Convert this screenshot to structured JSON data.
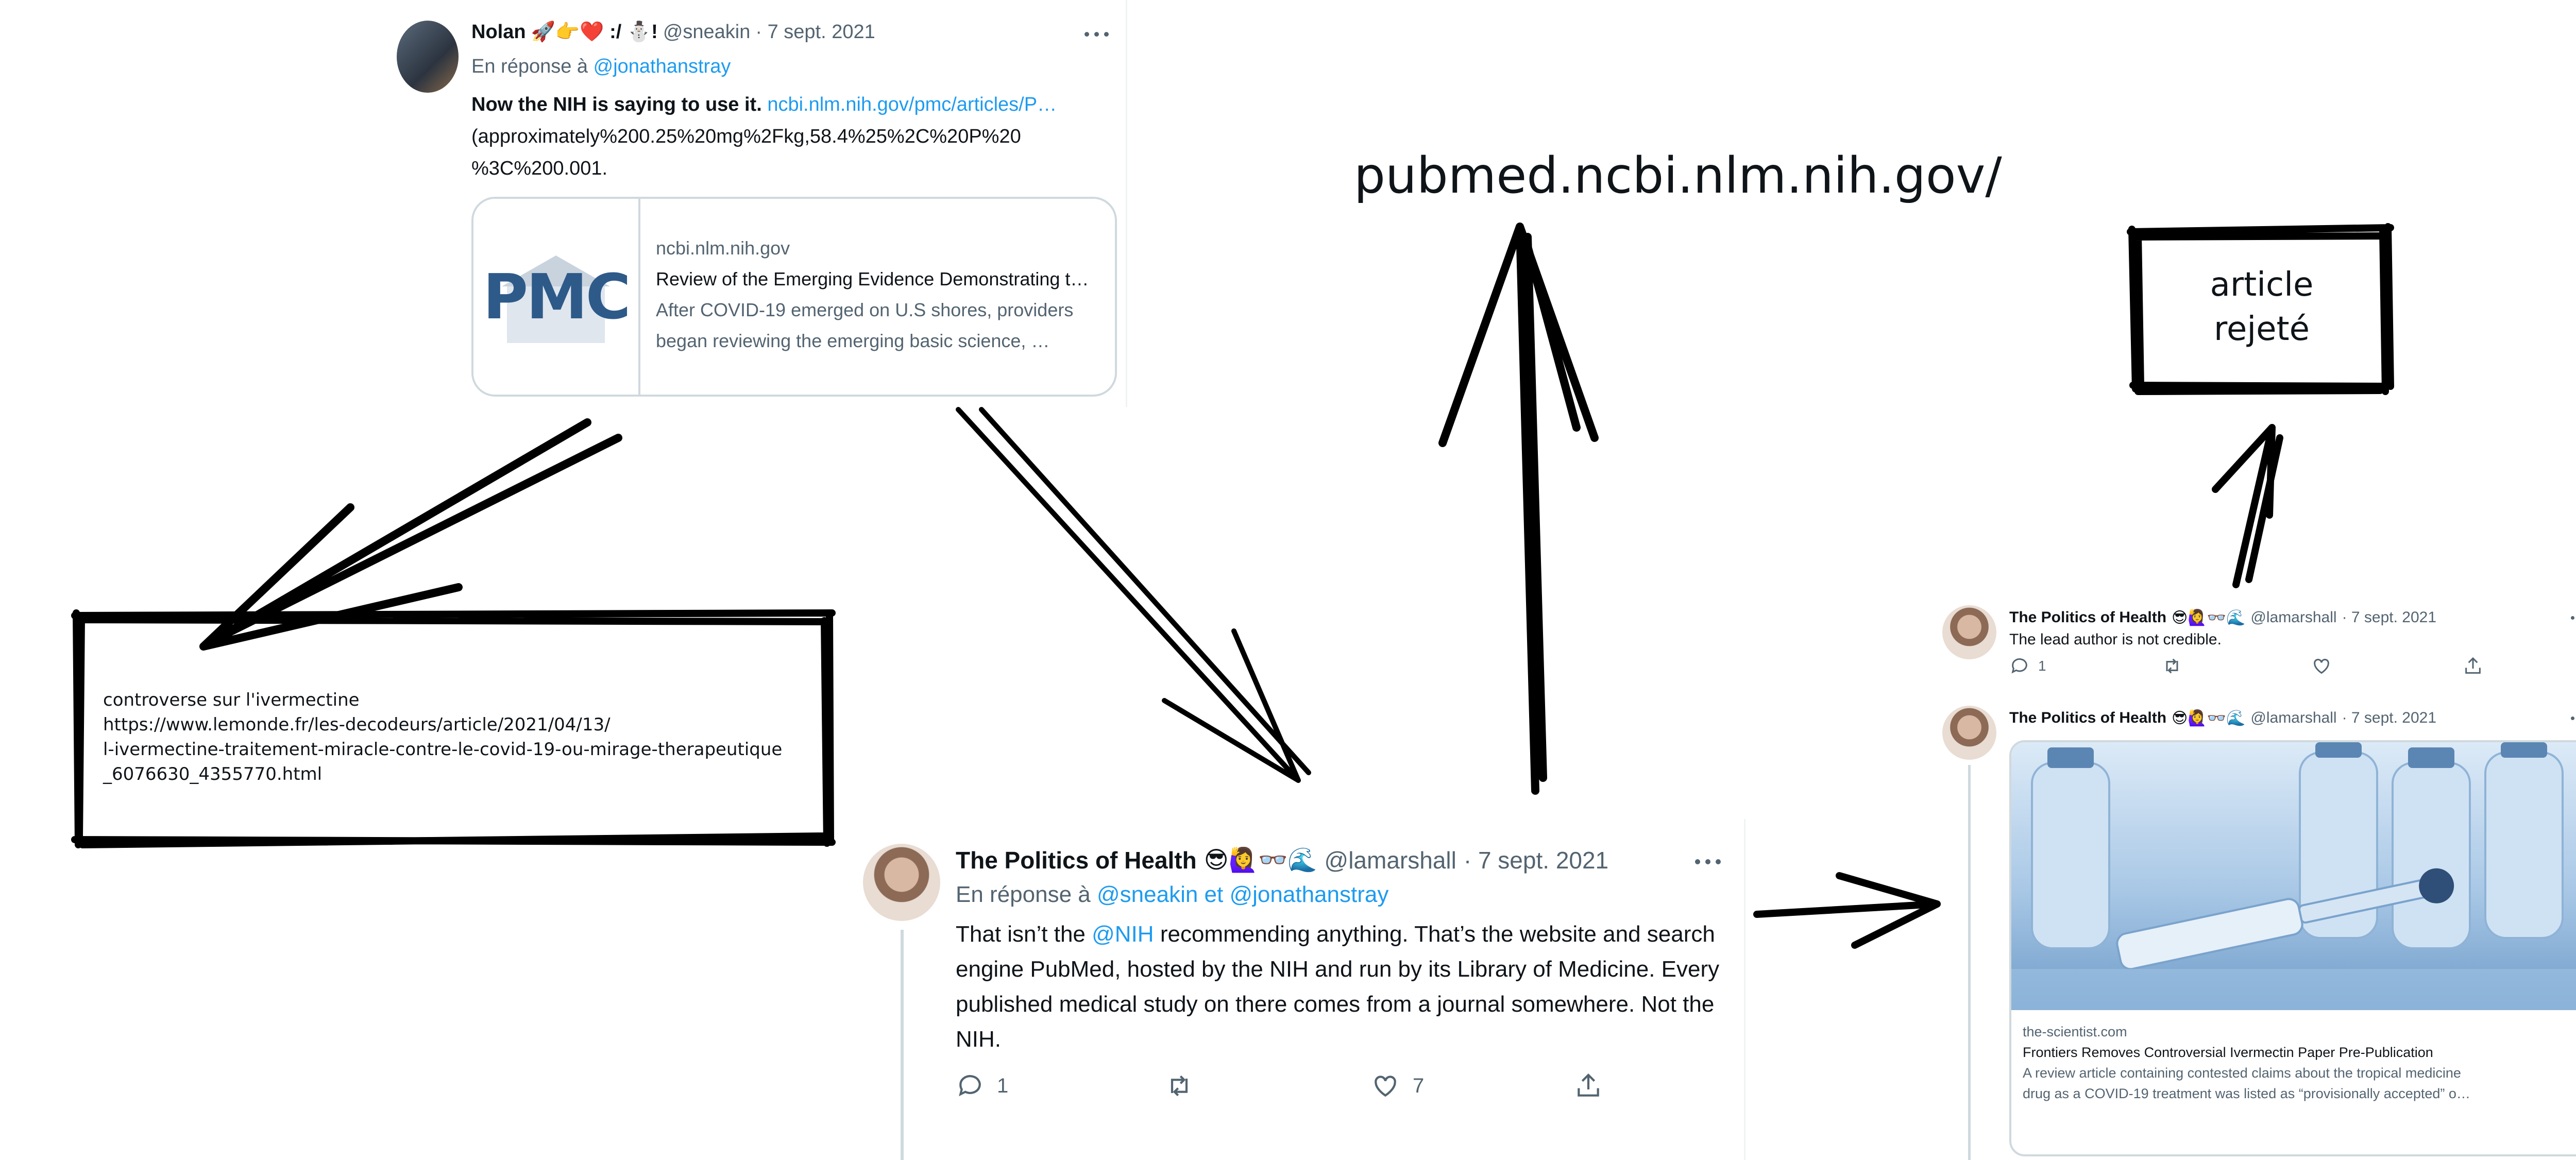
{
  "tweet1": {
    "author": "Nolan",
    "emoji": "🚀👉❤️ :/ ⛄!",
    "handle": "@sneakin",
    "date": "· 7 sept. 2021",
    "reply_prefix": "En réponse à",
    "reply_to": "@jonathanstray",
    "text_bold": "Now the NIH is saying to use it.",
    "text_link": "ncbi.nlm.nih.gov/pmc/articles/P…",
    "text_line2": "(approximately%200.25%20mg%2Fkg,58.4%25%2C%20P%20",
    "text_line3": "%3C%200.001.",
    "card": {
      "logo": "PMC",
      "domain": "ncbi.nlm.nih.gov",
      "title": "Review of the Emerging Evidence Demonstrating t…",
      "desc1": "After COVID-19 emerged on U.S shores, providers",
      "desc2": "began reviewing the emerging basic science, …"
    }
  },
  "note_box": {
    "line1": "controverse sur l'ivermectine",
    "line2": "https://www.lemonde.fr/les-decodeurs/article/2021/04/13/",
    "line3": "l-ivermectine-traitement-miracle-contre-le-covid-19-ou-mirage-therapeutique",
    "line4": "_6076630_4355770.html"
  },
  "pubmed_label": "pubmed.ncbi.nlm.nih.gov/",
  "rejected_box": {
    "line1": "article",
    "line2": "rejeté"
  },
  "tweet2": {
    "author": "The Politics of Health",
    "emoji": "😎🙋‍♀️👓🌊",
    "handle": "@lamarshall",
    "date": "· 7 sept. 2021",
    "reply_prefix": "En réponse à",
    "reply_to_1": "@sneakin",
    "reply_sep": "et",
    "reply_to_2": "@jonathanstray",
    "text_1a": "That isn’t the ",
    "text_1_mention": "@NIH",
    "text_1b": " recommending anything. That’s the website and search",
    "text_2": "engine PubMed, hosted by the NIH and run by its Library of Medicine. Every",
    "text_3": "published medical study on there comes from a journal somewhere. Not the",
    "text_4": "NIH.",
    "reply_count": "1",
    "like_count": "7"
  },
  "tweet3": {
    "author": "The Politics of Health",
    "emoji": "😎🙋‍♀️👓🌊",
    "handle": "@lamarshall",
    "date": "· 7 sept. 2021",
    "text": "The lead author is not credible.",
    "reply_count": "1"
  },
  "tweet4": {
    "author": "The Politics of Health",
    "emoji": "😎🙋‍♀️👓🌊",
    "handle": "@lamarshall",
    "date": "· 7 sept. 2021",
    "card": {
      "domain": "the-scientist.com",
      "title": "Frontiers Removes Controversial Ivermectin Paper Pre-Publication",
      "desc1": "A review article containing contested claims about the tropical medicine",
      "desc2": "drug as a COVID-19 treatment was listed as “provisionally accepted” o…"
    }
  },
  "colors": {
    "link": "#1d9bf0",
    "muted": "#536471",
    "text": "#0f1419",
    "border": "#cfd9de",
    "pmc_blue": "#2e5a89"
  }
}
